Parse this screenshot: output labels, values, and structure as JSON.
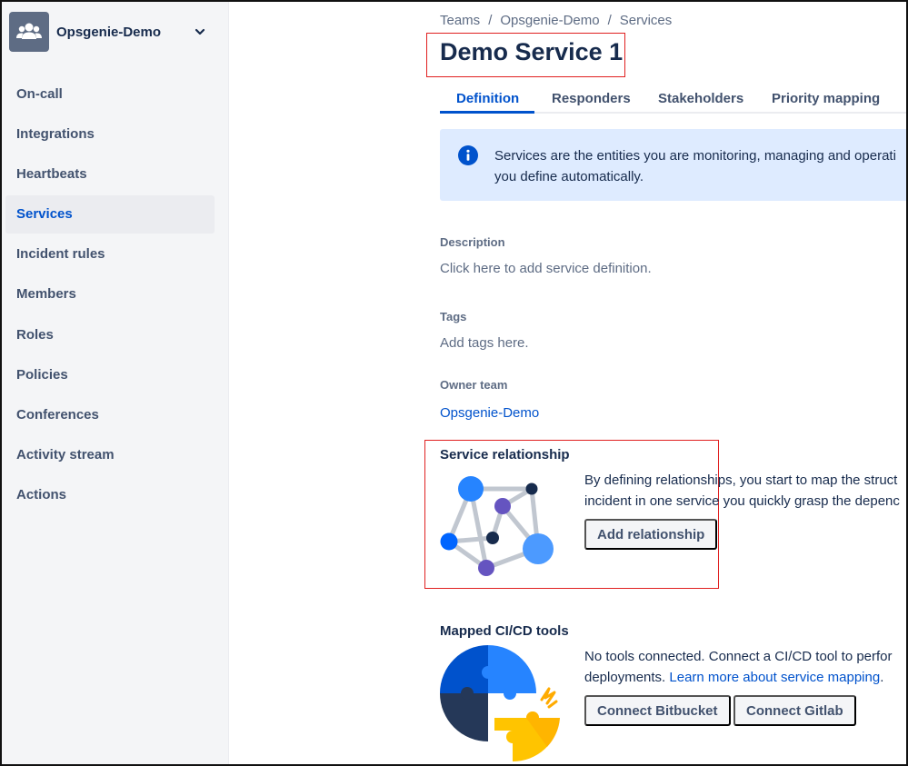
{
  "sidebar": {
    "team_name": "Opsgenie-Demo",
    "items": [
      {
        "label": "On-call"
      },
      {
        "label": "Integrations"
      },
      {
        "label": "Heartbeats"
      },
      {
        "label": "Services",
        "active": true
      },
      {
        "label": "Incident rules"
      },
      {
        "label": "Members"
      },
      {
        "label": "Roles"
      },
      {
        "label": "Policies"
      },
      {
        "label": "Conferences"
      },
      {
        "label": "Activity stream"
      },
      {
        "label": "Actions"
      }
    ]
  },
  "breadcrumb": [
    "Teams",
    "Opsgenie-Demo",
    "Services"
  ],
  "breadcrumb_separator": "/",
  "page_title": "Demo Service 1",
  "tabs": [
    {
      "label": "Definition",
      "active": true
    },
    {
      "label": "Responders"
    },
    {
      "label": "Stakeholders"
    },
    {
      "label": "Priority mapping"
    }
  ],
  "info": {
    "line1": "Services are the entities you are monitoring, managing and operati",
    "line2": "you define automatically."
  },
  "description": {
    "label": "Description",
    "value": "Click here to add service definition."
  },
  "tags": {
    "label": "Tags",
    "value": "Add tags here."
  },
  "owner_team": {
    "label": "Owner team",
    "value": "Opsgenie-Demo"
  },
  "service_relationship": {
    "title": "Service relationship",
    "line1": "By defining relationships, you start to map the struct",
    "line2": "incident in one service you quickly grasp the depenc",
    "button": "Add relationship"
  },
  "cicd": {
    "title": "Mapped CI/CD tools",
    "line1": "No tools connected. Connect a CI/CD tool to perfor",
    "line2_prefix": "deployments.",
    "line2_link": "Learn more about service mapping",
    "line2_suffix": ".",
    "buttons": [
      "Connect Bitbucket",
      "Connect Gitlab"
    ]
  },
  "colors": {
    "accent": "#0052cc",
    "sidebar_bg": "#f4f5f7",
    "info_bg": "#deebff",
    "highlight": "#e02020"
  },
  "icons": [
    "team-icon",
    "chevron-down-icon",
    "info-icon",
    "network-graph-illustration",
    "puzzle-illustration"
  ]
}
